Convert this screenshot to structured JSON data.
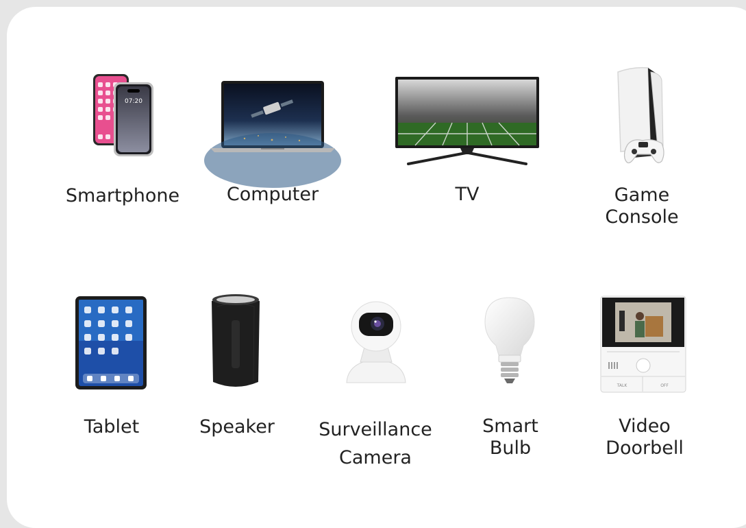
{
  "devices": [
    {
      "key": "smartphone",
      "label": "Smartphone",
      "icon": "smartphone-icon"
    },
    {
      "key": "computer",
      "label": "Computer",
      "icon": "laptop-icon"
    },
    {
      "key": "tv",
      "label": "TV",
      "icon": "tv-icon"
    },
    {
      "key": "game_console",
      "label_line1": "Game",
      "label_line2": "Console",
      "icon": "game-console-icon"
    },
    {
      "key": "tablet",
      "label": "Tablet",
      "icon": "tablet-icon"
    },
    {
      "key": "speaker",
      "label": "Speaker",
      "icon": "speaker-icon"
    },
    {
      "key": "camera",
      "label_line1": "Surveillance",
      "label_line2": "Camera",
      "icon": "surveillance-camera-icon"
    },
    {
      "key": "bulb",
      "label_line1": "Smart",
      "label_line2": "Bulb",
      "icon": "smart-bulb-icon"
    },
    {
      "key": "doorbell",
      "label_line1": "Video",
      "label_line2": "Doorbell",
      "icon": "video-doorbell-icon"
    }
  ],
  "phone_screen_time": "07:20",
  "doorbell_buttons": {
    "talk": "TALK",
    "off": "OFF"
  },
  "colors": {
    "background": "#e6e6e6",
    "card": "#ffffff",
    "label_text": "#222222"
  }
}
